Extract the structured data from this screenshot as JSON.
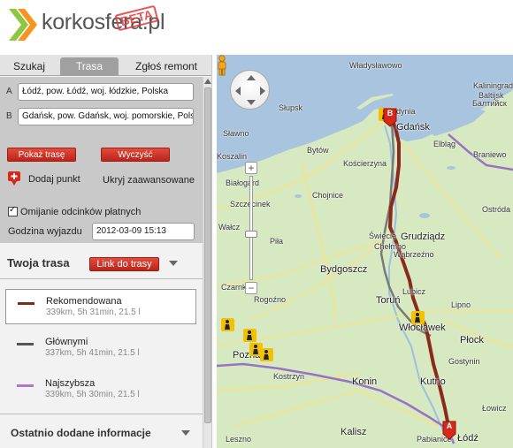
{
  "header": {
    "logo_text": "korkosfera.pl",
    "beta_label": "BETA",
    "logo_colors": {
      "green": "#8dc63f",
      "orange": "#f7941d",
      "red": "#e23a3a"
    }
  },
  "tabs": [
    {
      "label": "Szukaj",
      "active": false
    },
    {
      "label": "Trasa",
      "active": true
    },
    {
      "label": "Zgłoś remont",
      "active": false
    }
  ],
  "route_form": {
    "point_a_letter": "A",
    "point_a_value": "Łódź, pow. Łódź, woj. łódzkie, Polska",
    "point_b_letter": "B",
    "point_b_value": "Gdańsk, pow. Gdańsk, woj. pomorskie, Polska",
    "show_route_label": "Pokaż trasę",
    "clear_label": "Wyczyść",
    "add_point_label": "Dodaj punkt",
    "hide_advanced_label": "Ukryj zaawansowane",
    "toll_label": "Omijanie odcinków płatnych",
    "toll_checked": true,
    "departure_label": "Godzina wyjazdu",
    "departure_value": "2012-03-09 15:13"
  },
  "your_route": {
    "title": "Twoja trasa",
    "link_label": "Link do trasy",
    "options": [
      {
        "name": "Rekomendowana",
        "stats": "339km, 5h 31min, 21.5 l",
        "color": "#7b2c20",
        "selected": true
      },
      {
        "name": "Głównymi",
        "stats": "337km, 5h 41min, 21.5 l",
        "color": "#555555",
        "selected": false
      },
      {
        "name": "Najszybsza",
        "stats": "339km, 5h 30min, 21.5 l",
        "color": "#b176c9",
        "selected": false
      }
    ]
  },
  "recent_info": {
    "title": "Ostatnio dodane informacje"
  },
  "map": {
    "colors": {
      "land": "#d6e9c0",
      "sea": "#a8c4de",
      "route_recommended": "#8b2a1c",
      "route_main": "#7a7a7a",
      "route_fastest": "#9a72c4"
    },
    "marker_a": "A",
    "marker_b": "B",
    "labels": {
      "wladyslawowo": "Władysławowo",
      "slupsk": "Słupsk",
      "gdynia": "Gdynia",
      "gdansk": "Gdańsk",
      "kaliningrad": "Kaliningrad",
      "baltijsk": "Baltijsk",
      "baltiysk2": "Балтийск",
      "elblag": "Elbląg",
      "braniewo": "Braniewo",
      "slawno": "Sławno",
      "koszalin": "Koszalin",
      "bytow": "Bytów",
      "koscierzyna": "Kościerzyna",
      "ostroda": "Ostróda",
      "bialogard": "Białogard",
      "szczecinek": "Szczecinek",
      "chojnice": "Chojnice",
      "walcz": "Wałcz",
      "swiecie": "Świecie",
      "grudziadz": "Grudziądz",
      "chelmno": "Chełmno",
      "wabrzezno": "Wąbrzeźno",
      "pila": "Piła",
      "bydgoszcz": "Bydgoszcz",
      "torun": "Toruń",
      "lubicz": "Lubicz",
      "czarnkow": "Czarnków",
      "lipno": "Lipno",
      "rogozno": "Rogoźno",
      "wloclawek": "Włocławek",
      "plock": "Płock",
      "poznan": "Poznań",
      "konin": "Konin",
      "kutno": "Kutno",
      "kostrzyn": "Kostrzyn",
      "gostynin": "Gostynin",
      "lodz": "Łódź",
      "kalisz": "Kalisz",
      "leszno": "Leszno",
      "pabianice": "Pabianice",
      "lowicz": "Łowicz"
    }
  }
}
